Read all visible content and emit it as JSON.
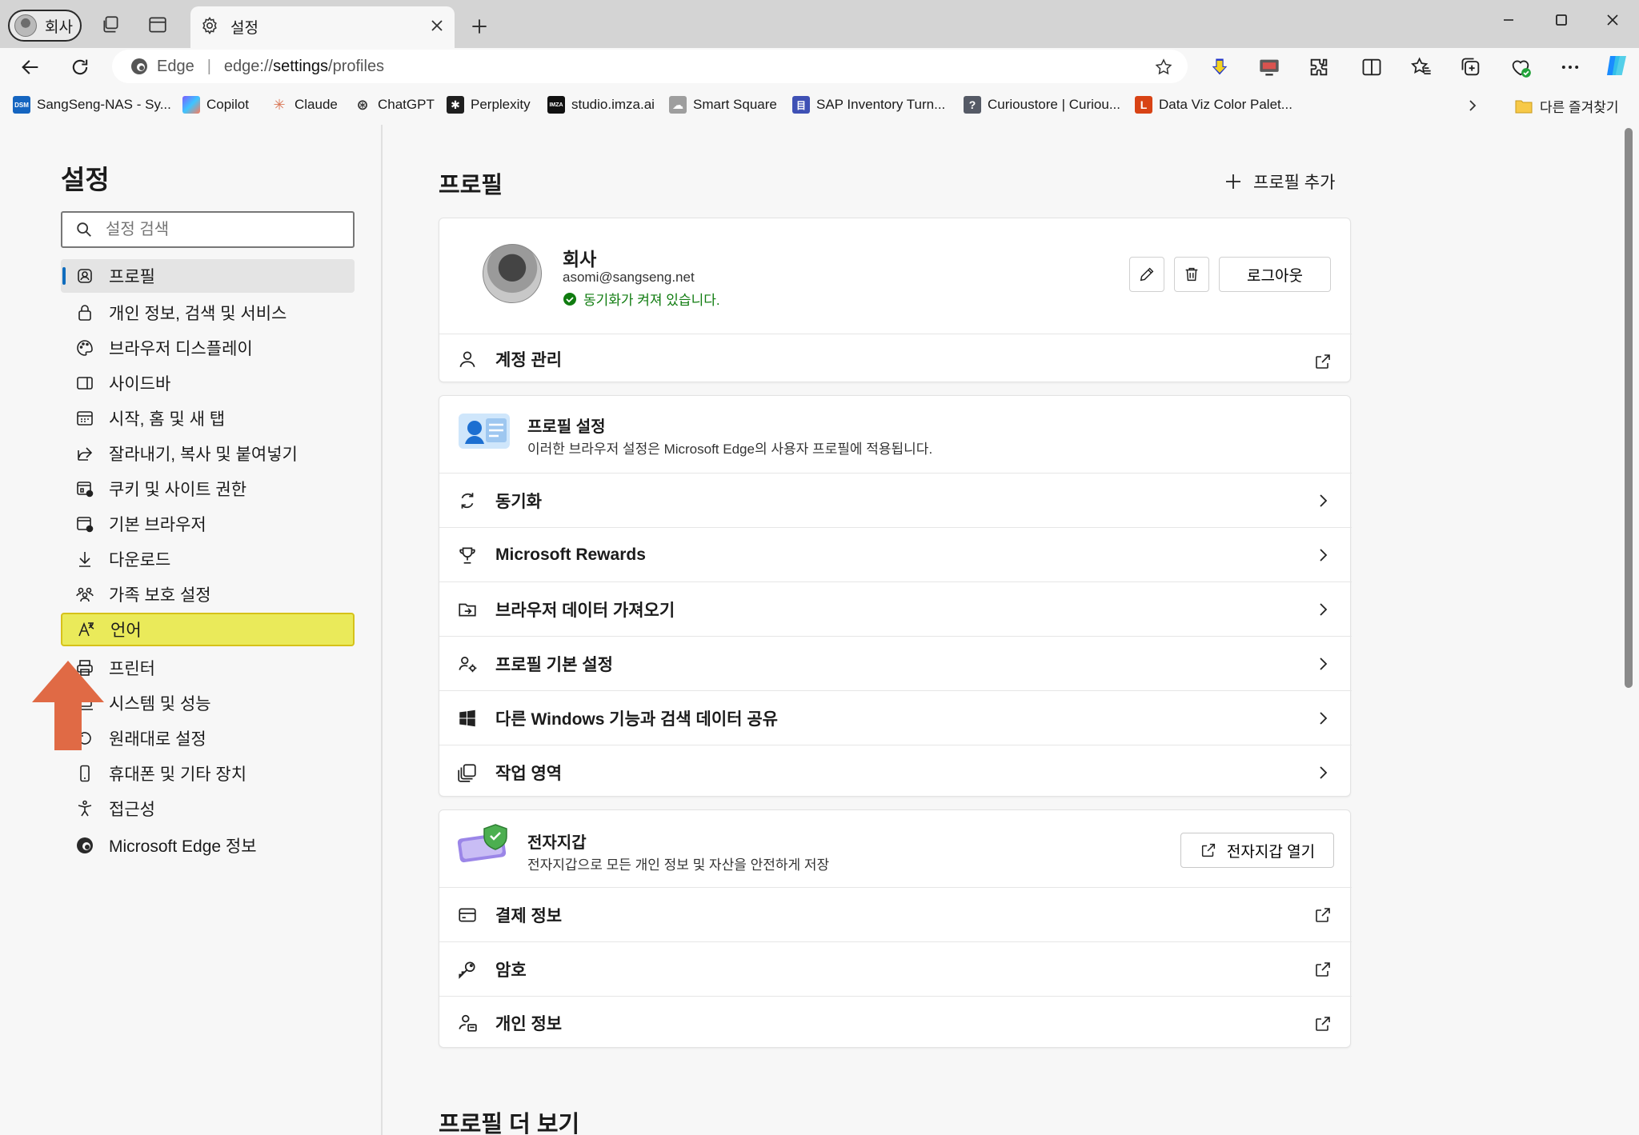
{
  "browser": {
    "profile_button": "회사",
    "active_tab_title": "설정",
    "address_prefix": "Edge",
    "address_scheme": "edge://",
    "address_host": "settings",
    "address_path": "/profiles"
  },
  "favorites": [
    {
      "label": "SangSeng-NAS - Sy...",
      "icon_text": "DSM",
      "color": "#1565c0"
    },
    {
      "label": "Copilot",
      "icon_text": "",
      "color": "#7b5cff"
    },
    {
      "label": "Claude",
      "icon_text": "✳",
      "color": "#d97757"
    },
    {
      "label": "ChatGPT",
      "icon_text": "⊛",
      "color": "#333333"
    },
    {
      "label": "Perplexity",
      "icon_text": "✱",
      "color": "#1f1f1f"
    },
    {
      "label": "studio.imza.ai",
      "icon_text": "IMZA",
      "color": "#111111"
    },
    {
      "label": "Smart Square",
      "icon_text": "☁",
      "color": "#9e9e9e"
    },
    {
      "label": "SAP Inventory Turn...",
      "icon_text": "目",
      "color": "#3f51b5"
    },
    {
      "label": "Curioustore | Curiou...",
      "icon_text": "?",
      "color": "#555a66"
    },
    {
      "label": "Data Viz Color Palet...",
      "icon_text": "L",
      "color": "#d84315"
    }
  ],
  "other_favorites": "다른 즐겨찾기",
  "sidebar": {
    "title": "설정",
    "search_placeholder": "설정 검색",
    "items": [
      {
        "label": "프로필",
        "icon": "profile-icon"
      },
      {
        "label": "개인 정보, 검색 및 서비스",
        "icon": "lock-icon"
      },
      {
        "label": "브라우저 디스플레이",
        "icon": "palette-icon"
      },
      {
        "label": "사이드바",
        "icon": "sidebar-icon"
      },
      {
        "label": "시작, 홈 및 새 탭",
        "icon": "home-tab-icon"
      },
      {
        "label": "잘라내기, 복사 및 붙여넣기",
        "icon": "share-icon"
      },
      {
        "label": "쿠키 및 사이트 권한",
        "icon": "cookie-icon"
      },
      {
        "label": "기본 브라우저",
        "icon": "browser-icon"
      },
      {
        "label": "다운로드",
        "icon": "download-icon"
      },
      {
        "label": "가족 보호 설정",
        "icon": "family-icon"
      },
      {
        "label": "언어",
        "icon": "language-icon"
      },
      {
        "label": "프린터",
        "icon": "printer-icon"
      },
      {
        "label": "시스템 및 성능",
        "icon": "system-icon"
      },
      {
        "label": "원래대로 설정",
        "icon": "reset-icon"
      },
      {
        "label": "휴대폰 및 기타 장치",
        "icon": "phone-icon"
      },
      {
        "label": "접근성",
        "icon": "accessibility-icon"
      },
      {
        "label": "Microsoft Edge 정보",
        "icon": "edge-icon"
      }
    ]
  },
  "main": {
    "title": "프로필",
    "add_profile": "프로필 추가",
    "profile": {
      "name": "회사",
      "email": "asomi@sangseng.net",
      "sync_status": "동기화가 켜져 있습니다.",
      "logout": "로그아웃"
    },
    "account_manage": "계정 관리",
    "profile_settings": {
      "title": "프로필 설정",
      "description": "이러한 브라우저 설정은 Microsoft Edge의 사용자 프로필에 적용됩니다.",
      "rows": [
        {
          "label": "동기화",
          "icon": "sync-icon"
        },
        {
          "label": "Microsoft Rewards",
          "icon": "trophy-icon"
        },
        {
          "label": "브라우저 데이터 가져오기",
          "icon": "import-icon"
        },
        {
          "label": "프로필 기본 설정",
          "icon": "profile-prefs-icon"
        },
        {
          "label": "다른 Windows 기능과 검색 데이터 공유",
          "icon": "windows-icon"
        },
        {
          "label": "작업 영역",
          "icon": "workspaces-icon"
        }
      ]
    },
    "wallet": {
      "title": "전자지갑",
      "description": "전자지갑으로 모든 개인 정보 및 자산을 안전하게 저장",
      "open_button": "전자지갑 열기",
      "rows": [
        {
          "label": "결제 정보",
          "icon": "card-icon"
        },
        {
          "label": "암호",
          "icon": "key-icon"
        },
        {
          "label": "개인 정보",
          "icon": "personal-info-icon"
        }
      ]
    },
    "more_profiles": "프로필 더 보기"
  },
  "colors": {
    "accent": "#0f6cbd",
    "highlight": "#eaea5a",
    "sync_green": "#107c10",
    "arrow": "#e06a45"
  }
}
